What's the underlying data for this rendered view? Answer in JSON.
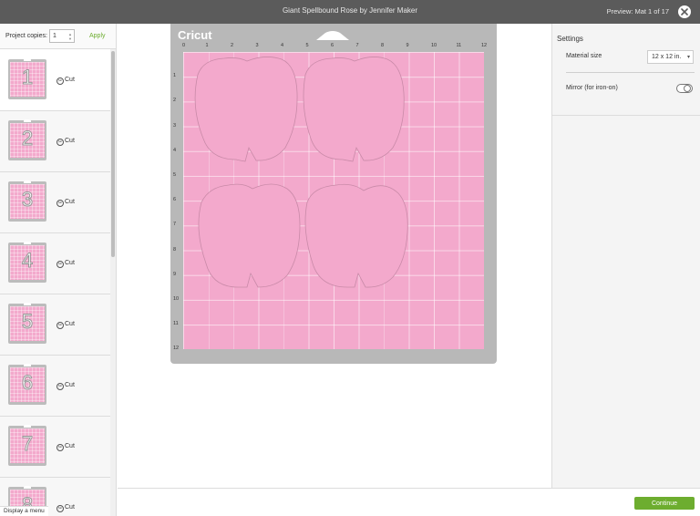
{
  "window": {
    "title": "Giant Spellbound Rose by Jennifer Maker",
    "preview_label": "Preview: Mat 1 of 17"
  },
  "left_panel": {
    "copies_label": "Project copies:",
    "copies_value": "1",
    "apply_label": "Apply",
    "mats": [
      {
        "number": "1",
        "label": "Cut"
      },
      {
        "number": "2",
        "label": "Cut"
      },
      {
        "number": "3",
        "label": "Cut"
      },
      {
        "number": "4",
        "label": "Cut"
      },
      {
        "number": "5",
        "label": "Cut"
      },
      {
        "number": "6",
        "label": "Cut"
      },
      {
        "number": "7",
        "label": "Cut"
      },
      {
        "number": "8",
        "label": "Cut"
      }
    ],
    "display_menu_label": "Display a menu"
  },
  "mat": {
    "brand": "Cricut",
    "ruler_top": [
      "0",
      "1",
      "2",
      "3",
      "4",
      "5",
      "6",
      "7",
      "8",
      "9",
      "10",
      "11",
      "12"
    ],
    "ruler_left": [
      "1",
      "2",
      "3",
      "4",
      "5",
      "6",
      "7",
      "8",
      "9",
      "10",
      "11",
      "12"
    ],
    "color": "#f3a9cc"
  },
  "settings": {
    "title": "Settings",
    "material_size_label": "Material size",
    "material_size_value": "12 x 12 in.",
    "mirror_label": "Mirror (for iron-on)"
  },
  "footer": {
    "continue_label": "Continue"
  },
  "colors": {
    "accent": "#6dad2f",
    "titlebar": "#5b5b5b"
  }
}
